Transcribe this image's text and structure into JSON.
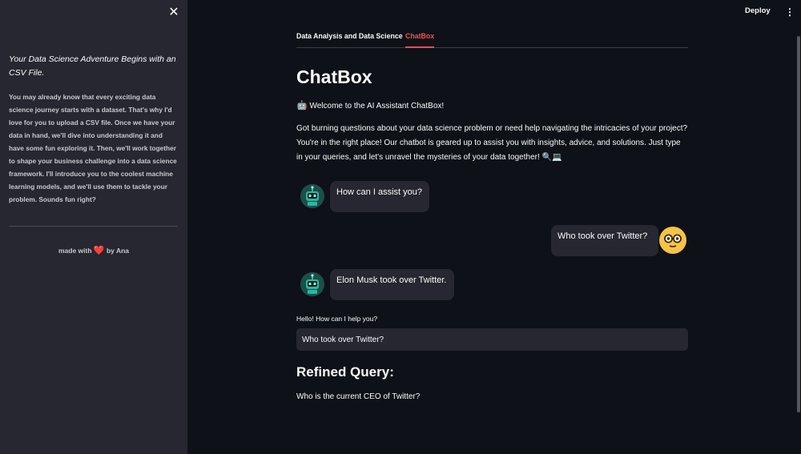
{
  "sidebar": {
    "heading": "Your Data Science Adventure Begins with an CSV File.",
    "body": "You may already know that every exciting data science journey starts with a dataset. That's why I'd love for you to upload a CSV file. Once we have your data in hand, we'll dive into understanding it and have some fun exploring it. Then, we'll work together to shape your business challenge into a data science framework. I'll introduce you to the coolest machine learning models, and we'll use them to tackle your problem. Sounds fun right?",
    "footer_prefix": "made with",
    "footer_suffix": "by Ana",
    "close_icon": "close-icon"
  },
  "header": {
    "deploy_label": "Deploy",
    "menu_icon": "kebab-menu-icon"
  },
  "tabs": [
    {
      "label": "Data Analysis and Data Science",
      "active": false
    },
    {
      "label": "ChatBox",
      "active": true
    }
  ],
  "main": {
    "title": "ChatBox",
    "welcome": "Welcome to the AI Assistant ChatBox!",
    "intro": "Got burning questions about your data science problem or need help navigating the intricacies of your project? You're in the right place! Our chatbot is geared up to assist you with insights, advice, and solutions. Just type in your queries, and let's unravel the mysteries of your data together! 🔍💻"
  },
  "chat": [
    {
      "role": "bot",
      "text": "How can I assist you?"
    },
    {
      "role": "user",
      "text": "Who took over Twitter?"
    },
    {
      "role": "bot",
      "text": "Elon Musk took over Twitter."
    }
  ],
  "input": {
    "label": "Hello! How can I help you?",
    "value": "Who took over Twitter?"
  },
  "refined": {
    "heading": "Refined Query:",
    "text": "Who is the current CEO of Twitter?"
  },
  "colors": {
    "accent": "#ff4b4b",
    "background": "#0e1117",
    "sidebar": "#262730",
    "bubble": "#262730"
  }
}
